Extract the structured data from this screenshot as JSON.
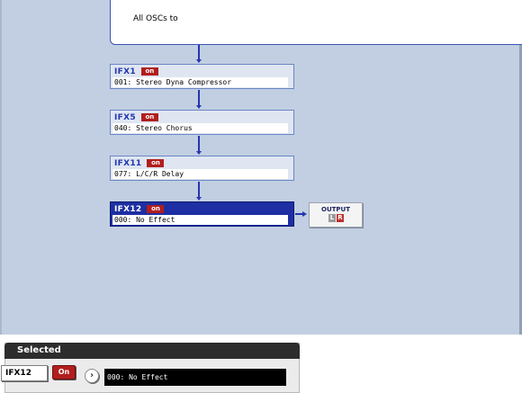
{
  "source": {
    "text": "All OSCs to"
  },
  "chain": [
    {
      "name": "IFX1",
      "status": "on",
      "effect": "001: Stereo Dyna Compressor"
    },
    {
      "name": "IFX5",
      "status": "on",
      "effect": "040: Stereo Chorus"
    },
    {
      "name": "IFX11",
      "status": "on",
      "effect": "077: L/C/R Delay"
    },
    {
      "name": "IFX12",
      "status": "on",
      "effect": "000: No Effect"
    }
  ],
  "output": {
    "label": "OUTPUT",
    "left": "L",
    "right": "R"
  },
  "selected_panel": {
    "title": "Selected",
    "slot": "IFX12",
    "on_label": "On",
    "arrow": "›",
    "effect": "000: No Effect"
  },
  "colors": {
    "canvas_bg": "#c2cfe2",
    "connector": "#2336b0",
    "selected_block": "#1d2fa2",
    "on_badge": "#b21e1e"
  }
}
